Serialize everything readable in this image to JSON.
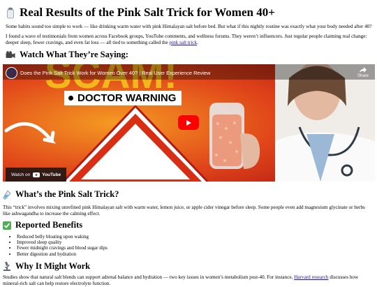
{
  "header": {
    "emoji": "salt-shaker-icon",
    "title": "Real Results of the Pink Salt Trick for Women 40+"
  },
  "intro": {
    "p1": "Some habits sound too simple to work — like drinking warm water with pink Himalayan salt before bed. But what if this nightly routine was exactly what your body needed after 40?",
    "p2_text": "I found a wave of testimonials from women across Facebook groups, YouTube comments, and wellness forums. They weren’t influencers. Just regular people claiming real change: deeper sleep, fewer cravings, and even fat loss — all tied to something called the ",
    "p2_link": "pink salt trick",
    "p2_end": "."
  },
  "watch_section": {
    "emoji": "movie-camera-icon",
    "heading": "Watch What They’re Saying:"
  },
  "video": {
    "title": "Does the Pink Salt Trick Work for Women Over 40? | Real User Experience Review",
    "share_label": "Share",
    "overlay_text": "DOCTOR WARNING",
    "watch_on": "Watch on",
    "youtube_label": "YouTube",
    "colors": {
      "background": "#d72e14",
      "yellow": "#f4c21b",
      "play": "#ff0000"
    }
  },
  "what_section": {
    "emoji": "test-tube-icon",
    "heading": "What’s the Pink Salt Trick?",
    "body": "This “trick” involves mixing unrefined pink Himalayan salt with warm water, lemon juice, or apple cider vinegar before sleep. Some people even add magnesium glycinate or herbs like ashwagandha to increase the calming effect."
  },
  "benefits_section": {
    "emoji": "check-mark-icon",
    "heading": "Reported Benefits",
    "items": [
      "Reduced belly bloating upon waking",
      "Improved sleep quality",
      "Fewer midnight cravings and blood sugar dips",
      "Better digestion and hydration"
    ]
  },
  "why_section": {
    "emoji": "microscope-icon",
    "heading": "Why It Might Work",
    "body_start": "Studies show that natural salt blends can support adrenal balance and hydration — two key issues in women’s metabolism post-40. For instance, ",
    "link": "Harvard research",
    "body_end": " discusses how mineral-rich salt can help restore electrolyte function."
  }
}
